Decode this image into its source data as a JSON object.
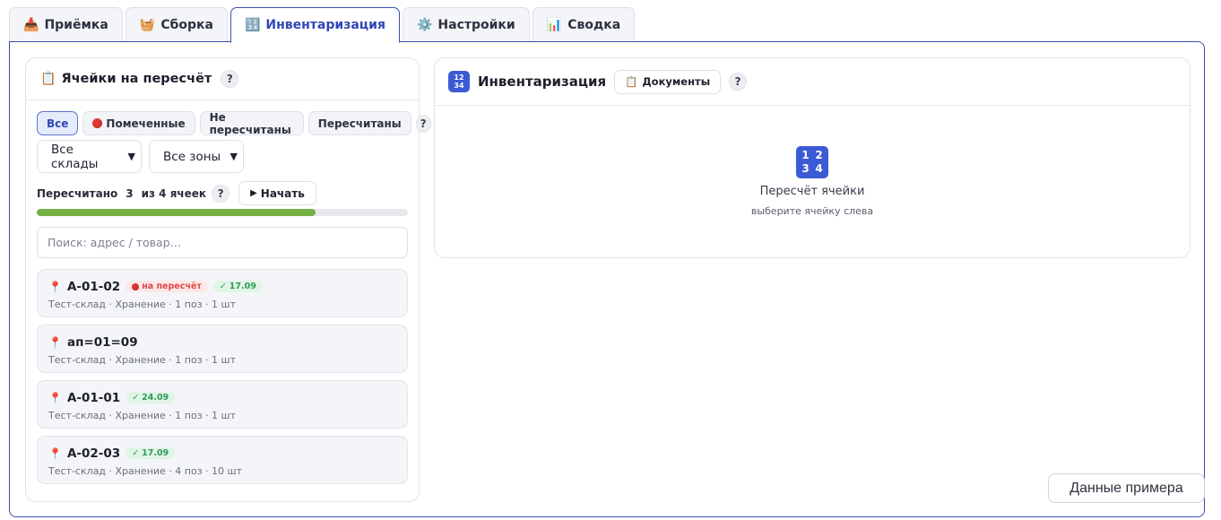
{
  "tabs": [
    {
      "icon": "📥",
      "label": "Приёмка"
    },
    {
      "icon": "🧺",
      "label": "Сборка"
    },
    {
      "icon": "🔢",
      "label": "Инвентаризация"
    },
    {
      "icon": "⚙️",
      "label": "Настройки"
    },
    {
      "icon": "📊",
      "label": "Сводка"
    }
  ],
  "active_tab": "Инвентаризация",
  "left": {
    "icon": "📋",
    "title": "Ячейки на пересчёт",
    "help": "?",
    "filters": [
      "Все",
      "Помеченные",
      "Не пересчитаны",
      "Пересчитаны"
    ],
    "active_filter": "Все",
    "warehouse_select": "Все склады",
    "zone_select": "Все зоны",
    "progress": {
      "label": "Пересчитано",
      "done": "3",
      "of_text": "из 4 ячеек",
      "fraction": 0.75
    },
    "start_label": "Начать",
    "search_placeholder": "Поиск: адрес / товар…",
    "cells": [
      {
        "addr": "A-01-02",
        "flag": "на пересчёт",
        "date": "17.09",
        "sub": "Тест-склад · Хранение · 1 поз · 1 шт"
      },
      {
        "addr": "ап=01=09",
        "flag": "",
        "date": "",
        "sub": "Тест-склад · Хранение · 1 поз · 1 шт"
      },
      {
        "addr": "A-01-01",
        "flag": "",
        "date": "24.09",
        "sub": "Тест-склад · Хранение · 1 поз · 1 шт"
      },
      {
        "addr": "A-02-03",
        "flag": "",
        "date": "17.09",
        "sub": "Тест-склад · Хранение · 4 поз · 10 шт"
      }
    ]
  },
  "right": {
    "title": "Инвентаризация",
    "docs_icon": "📋",
    "docs_label": "Документы",
    "help": "?",
    "empty_title": "Пересчёт ячейки",
    "empty_sub": "выберите ячейку слева"
  },
  "sample_button": "Данные примера",
  "colors": {
    "accent": "#3146b6",
    "progress": "#74b043",
    "danger": "#e04848",
    "success": "#2f9b55"
  }
}
